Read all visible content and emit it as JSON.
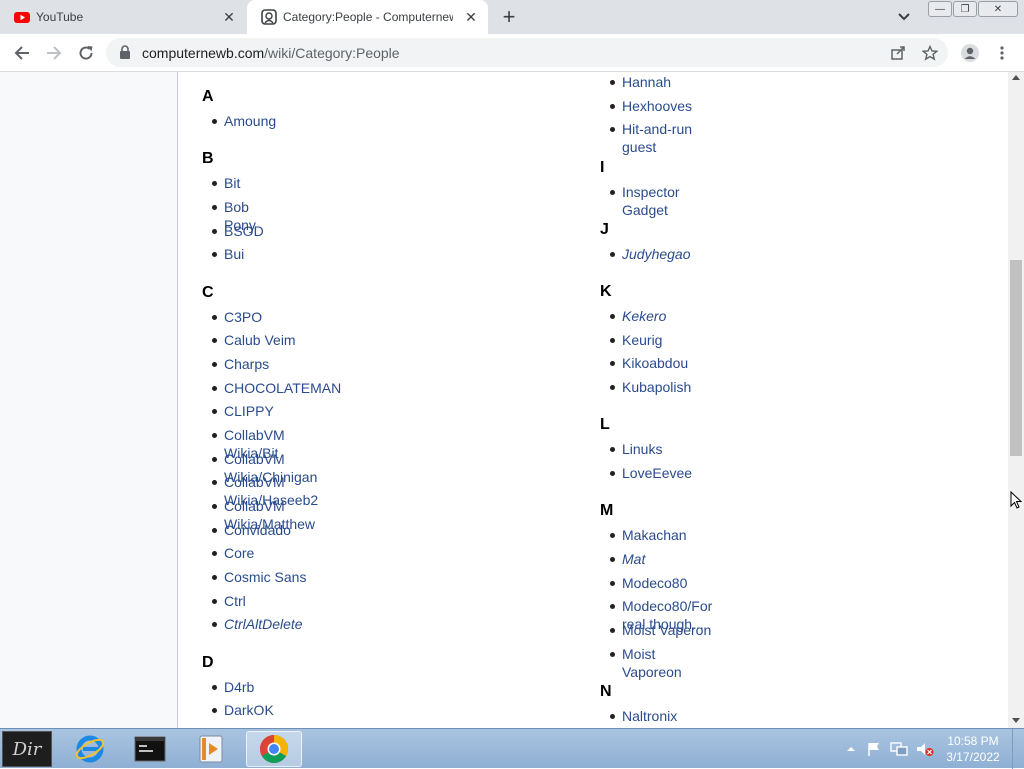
{
  "browser": {
    "tabs": [
      {
        "title": "YouTube",
        "icon": "youtube-icon",
        "active": false
      },
      {
        "title": "Category:People - Computernewb",
        "icon": "computernewb-icon",
        "active": true
      }
    ],
    "close_glyph": "✕",
    "new_tab_glyph": "+",
    "window_controls": {
      "minimize": "—",
      "restore": "❐",
      "close": "✕"
    },
    "url_host": "computernewb.com",
    "url_path": "/wiki/Category:People"
  },
  "left_column": [
    {
      "letter": "A",
      "items": [
        {
          "text": "Amoung",
          "italic": false
        }
      ]
    },
    {
      "letter": "B",
      "items": [
        {
          "text": "Bit",
          "italic": false
        },
        {
          "text": "Bob Pony",
          "italic": false
        },
        {
          "text": "BSOD",
          "italic": false
        },
        {
          "text": "Bui",
          "italic": false
        }
      ]
    },
    {
      "letter": "C",
      "items": [
        {
          "text": "C3PO",
          "italic": false
        },
        {
          "text": "Calub Veim",
          "italic": false
        },
        {
          "text": "Charps",
          "italic": false
        },
        {
          "text": "CHOCOLATEMAN",
          "italic": false
        },
        {
          "text": "CLIPPY",
          "italic": false
        },
        {
          "text": "CollabVM Wikia/Bit",
          "italic": false
        },
        {
          "text": "CollabVM Wikia/Chinigan",
          "italic": false
        },
        {
          "text": "CollabVM Wikia/Haseeb2",
          "italic": false
        },
        {
          "text": "CollabVM Wikia/Matthew",
          "italic": false
        },
        {
          "text": "Convidado",
          "italic": false
        },
        {
          "text": "Core",
          "italic": false
        },
        {
          "text": "Cosmic Sans",
          "italic": false
        },
        {
          "text": "Ctrl",
          "italic": false
        },
        {
          "text": "CtrlAltDelete",
          "italic": true
        }
      ]
    },
    {
      "letter": "D",
      "items": [
        {
          "text": "D4rb",
          "italic": false
        },
        {
          "text": "DarkOK",
          "italic": false
        }
      ]
    }
  ],
  "right_column": [
    {
      "letter": "",
      "items": [
        {
          "text": "Hannah",
          "italic": false
        },
        {
          "text": "Hexhooves",
          "italic": false
        },
        {
          "text": "Hit-and-run guest",
          "italic": false
        }
      ]
    },
    {
      "letter": "I",
      "items": [
        {
          "text": "Inspector Gadget",
          "italic": false
        }
      ]
    },
    {
      "letter": "J",
      "items": [
        {
          "text": "Judyhegao",
          "italic": true
        }
      ]
    },
    {
      "letter": "K",
      "items": [
        {
          "text": "Kekero",
          "italic": true
        },
        {
          "text": "Keurig",
          "italic": false
        },
        {
          "text": "Kikoabdou",
          "italic": false
        },
        {
          "text": "Kubapolish",
          "italic": false
        }
      ]
    },
    {
      "letter": "L",
      "items": [
        {
          "text": "Linuks",
          "italic": false
        },
        {
          "text": "LoveEevee",
          "italic": false
        }
      ]
    },
    {
      "letter": "M",
      "items": [
        {
          "text": "Makachan",
          "italic": false
        },
        {
          "text": "Mat",
          "italic": true
        },
        {
          "text": "Modeco80",
          "italic": false
        },
        {
          "text": "Modeco80/For real though...",
          "italic": false
        },
        {
          "text": "Moist Vaperon",
          "italic": false
        },
        {
          "text": "Moist Vaporeon",
          "italic": false
        }
      ]
    },
    {
      "letter": "N",
      "items": [
        {
          "text": "Naltronix",
          "italic": false
        }
      ]
    }
  ],
  "taskbar": {
    "start_label": "Dir",
    "items": [
      {
        "name": "internet-explorer-icon",
        "active": false
      },
      {
        "name": "terminal-icon",
        "active": false
      },
      {
        "name": "media-player-icon",
        "active": false
      },
      {
        "name": "chrome-icon",
        "active": true
      }
    ],
    "clock_time": "10:58 PM",
    "clock_date": "3/17/2022"
  },
  "colors": {
    "link": "#2a4b8d",
    "tab_strip": "#dee1e6",
    "taskbar": "#9ab8da"
  }
}
